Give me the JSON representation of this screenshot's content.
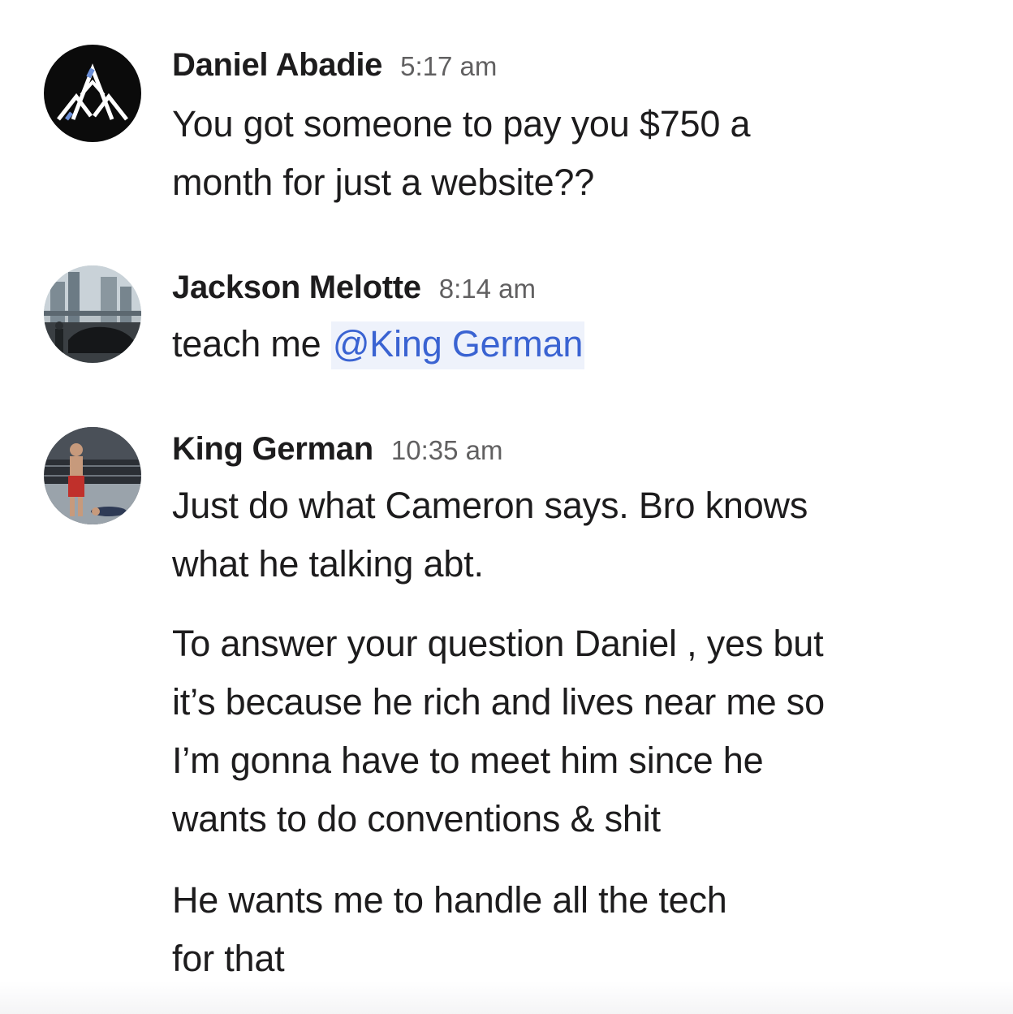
{
  "messages": [
    {
      "author": "Daniel Abadie",
      "time": "5:17 am",
      "avatar_icon": "mountain-logo-icon",
      "lines": [
        "You got someone to pay you $750 a",
        "month for just a website??"
      ]
    },
    {
      "author": "Jackson Melotte",
      "time": "8:14 am",
      "avatar_icon": "city-car-photo",
      "text_prefix": "teach me ",
      "mention": "@King German"
    },
    {
      "author": "King German",
      "time": "10:35 am",
      "avatar_icon": "fighter-photo",
      "paragraphs": [
        [
          "Just do what Cameron says. Bro knows",
          "what he talking abt."
        ],
        [
          "To answer your question Daniel , yes but",
          "it’s because he rich and lives near me so",
          "I’m gonna have to meet him since he",
          "wants to do conventions & shit"
        ],
        [
          "He wants me to handle all the tech",
          "for that"
        ]
      ]
    }
  ],
  "colors": {
    "text": "#1d1c1d",
    "timestamp": "#616061",
    "mention_text": "#3a63d2",
    "mention_bg": "#eef2fb"
  }
}
